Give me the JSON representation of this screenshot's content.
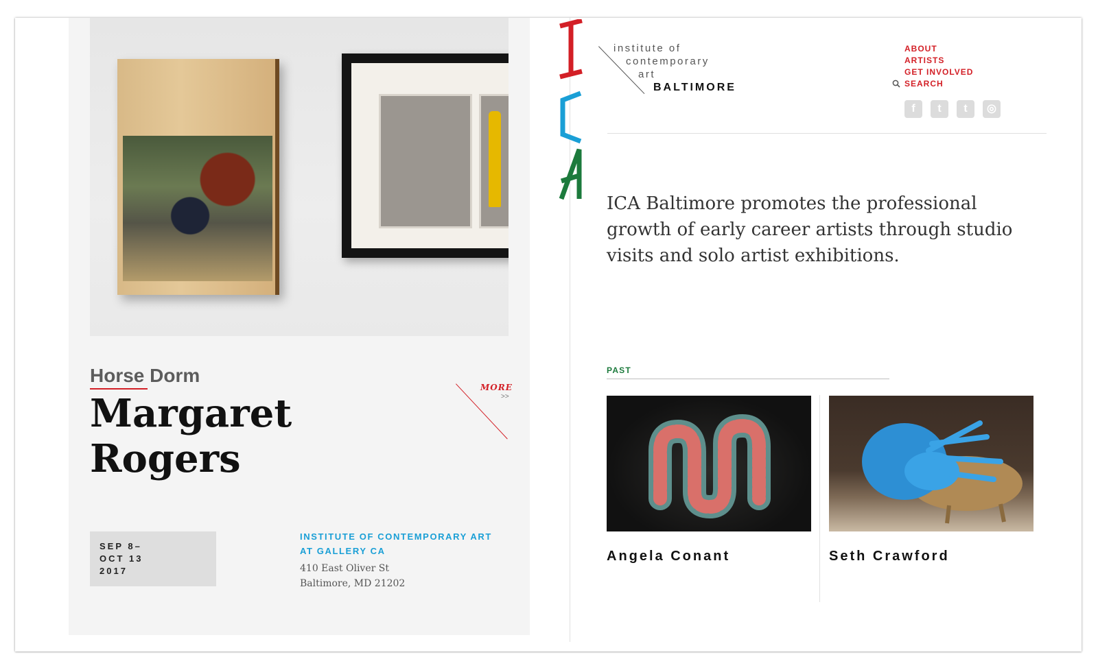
{
  "exhibition": {
    "subtitle": "Horse Dorm",
    "artist": "Margaret Rogers",
    "more_label": "MORE",
    "more_arrows": ">>",
    "dates": [
      "SEP 8–",
      "OCT 13",
      "2017"
    ],
    "venue_lines": [
      "INSTITUTE OF CONTEMPORARY ART",
      "AT GALLERY CA"
    ],
    "address_lines": [
      "410 East Oliver St",
      "Baltimore, MD 21202"
    ]
  },
  "logo": {
    "lines": [
      "institute of",
      "contemporary",
      "art",
      "BALTIMORE"
    ]
  },
  "nav": {
    "items": [
      "ABOUT",
      "ARTISTS",
      "GET INVOLVED",
      "SEARCH"
    ]
  },
  "socials": [
    {
      "name": "facebook-icon",
      "glyph": "f"
    },
    {
      "name": "twitter-icon",
      "glyph": "t"
    },
    {
      "name": "tumblr-icon",
      "glyph": "t"
    },
    {
      "name": "instagram-icon",
      "glyph": "◎"
    }
  ],
  "mission": "ICA Baltimore promotes the professional growth of early career artists through studio visits and solo artist exhibitions.",
  "past": {
    "label": "PAST",
    "cards": [
      {
        "name": "Angela Conant"
      },
      {
        "name": "Seth Crawford"
      }
    ]
  },
  "colors": {
    "red": "#d31f26",
    "blue": "#1a9fd6",
    "green": "#1c7a3c"
  }
}
